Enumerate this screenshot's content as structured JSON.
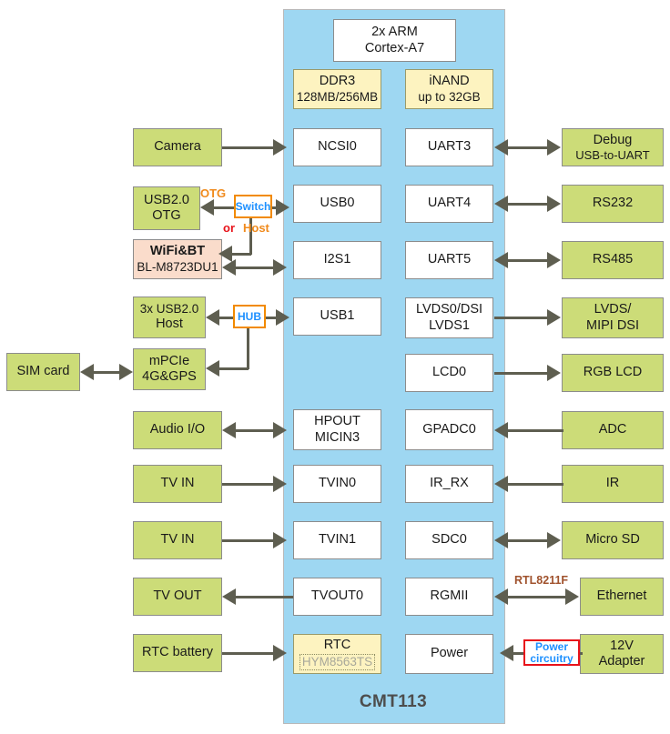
{
  "soc": {
    "name": "CMT113",
    "accent_color": "#9ed7f2",
    "peripheral_color": "#ccdc78",
    "memory_color": "#fdf3c0",
    "module_color": "#fadccb"
  },
  "soc_core": {
    "line1": "2x ARM",
    "line2": "Cortex-A7"
  },
  "memory": [
    {
      "line1": "DDR3",
      "line2": "128MB/256MB"
    },
    {
      "line1": "iNAND",
      "line2": "up to 32GB"
    }
  ],
  "soc_left_blocks": [
    {
      "line1": "NCSI0",
      "line2": ""
    },
    {
      "line1": "USB0",
      "line2": ""
    },
    {
      "line1": "I2S1",
      "line2": ""
    },
    {
      "line1": "USB1",
      "line2": ""
    },
    {
      "line1": "HPOUT",
      "line2": "MICIN3"
    },
    {
      "line1": "TVIN0",
      "line2": ""
    },
    {
      "line1": "TVIN1",
      "line2": ""
    },
    {
      "line1": "TVOUT0",
      "line2": ""
    },
    {
      "line1": "RTC",
      "line2": "HYM8563TS"
    }
  ],
  "soc_right_blocks": [
    {
      "line1": "UART3",
      "line2": ""
    },
    {
      "line1": "UART4",
      "line2": ""
    },
    {
      "line1": "UART5",
      "line2": ""
    },
    {
      "line1": "LVDS0/DSI",
      "line2": "LVDS1"
    },
    {
      "line1": "LCD0",
      "line2": ""
    },
    {
      "line1": "GPADC0",
      "line2": ""
    },
    {
      "line1": "IR_RX",
      "line2": ""
    },
    {
      "line1": "SDC0",
      "line2": ""
    },
    {
      "line1": "RGMII",
      "line2": ""
    },
    {
      "line1": "Power",
      "line2": ""
    }
  ],
  "left_peripherals": [
    {
      "line1": "Camera",
      "line2": ""
    },
    {
      "line1": "USB2.0",
      "line2": "OTG"
    },
    {
      "line1": "WiFi&BT",
      "line2": "BL-M8723DU1"
    },
    {
      "line1": "3x USB2.0",
      "line2": "Host"
    },
    {
      "line1": "mPCIe",
      "line2": "4G&GPS"
    },
    {
      "line1": "SIM card",
      "line2": ""
    },
    {
      "line1": "Audio I/O",
      "line2": ""
    },
    {
      "line1": "TV IN",
      "line2": ""
    },
    {
      "line1": "TV IN",
      "line2": ""
    },
    {
      "line1": "TV OUT",
      "line2": ""
    },
    {
      "line1": "RTC battery",
      "line2": ""
    }
  ],
  "right_peripherals": [
    {
      "line1": "Debug",
      "line2": "USB-to-UART"
    },
    {
      "line1": "RS232",
      "line2": ""
    },
    {
      "line1": "RS485",
      "line2": ""
    },
    {
      "line1": "LVDS/",
      "line2": "MIPI DSI"
    },
    {
      "line1": "RGB LCD",
      "line2": ""
    },
    {
      "line1": "ADC",
      "line2": ""
    },
    {
      "line1": "IR",
      "line2": ""
    },
    {
      "line1": "Micro SD",
      "line2": ""
    },
    {
      "line1": "Ethernet",
      "line2": ""
    },
    {
      "line1": "12V",
      "line2": "Adapter"
    }
  ],
  "tags": {
    "switch": "Switch",
    "hub": "HUB",
    "power_circuitry_l1": "Power",
    "power_circuitry_l2": "circuitry"
  },
  "notes": {
    "otg": "OTG",
    "or": "or",
    "host": "Host",
    "rtl": "RTL8211F"
  }
}
